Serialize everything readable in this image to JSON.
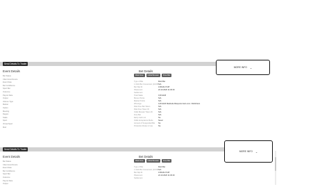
{
  "panel1": {
    "tag": "Send Details To Trader",
    "left_title": "Event Details",
    "left_items": [
      "Bet Status",
      "Client Host Device",
      "Event Date",
      "Bet Confidence",
      "Sport Bet",
      "Outcome",
      "Payout Date",
      "Output",
      "Volume Type",
      "Market",
      "Option",
      "Meeting",
      "Region",
      "Stake",
      "Sport",
      "Virtual Sport",
      "Mod"
    ],
    "right_title": "Bet Details",
    "chips": [
      "Risk Free",
      "Odds Booster",
      "Free Bet"
    ],
    "chip_counts": [
      "N/A",
      "N/A",
      "N/A"
    ],
    "rows": [
      {
        "k": "Type of Bet",
        "v": "Multi Bet"
      },
      {
        "k": "1 Click Bet Conversion (1CCB)",
        "v": "N/A"
      },
      {
        "k": "Bet Slip ID",
        "v": "1XRAKLYNJP"
      },
      {
        "k": "Placement",
        "v": "22.10.2020 11:36:40"
      },
      {
        "k": "Settlement",
        "v": ""
      },
      {
        "k": "Total Stake",
        "v": "0,00 EUR"
      },
      {
        "k": "Bonus Points",
        "v": "N/A"
      },
      {
        "k": "Market Points",
        "v": "N/A"
      },
      {
        "k": "Winnings",
        "v": "0,00 EUR  Mattitude Betsports.bwin.com / WebClient"
      },
      {
        "k": "Risk Free Bet Token",
        "v": "N/A"
      },
      {
        "k": "Risk Free Token ID",
        "v": "N/A"
      },
      {
        "k": "Odds Booster Token ID",
        "v": "N/A"
      },
      {
        "k": "Free Bet",
        "v": "N/A"
      },
      {
        "k": "Early Cash out",
        "v": "No"
      },
      {
        "k": "Odds Acceptance Mode",
        "v": "Never"
      },
      {
        "k": "Amount of Suspended Bet",
        "v": "No"
      },
      {
        "k": "Protection Rules in Use",
        "v": "No"
      }
    ],
    "more_info": "MORE INFO"
  },
  "panel2": {
    "tag": "Send Details To Trader",
    "left_title": "Event Details",
    "left_items": [
      "Bet Status",
      "Client Host Device",
      "Event Date",
      "Bet Confidence",
      "Sport Bet",
      "Outcome",
      "Payout Date",
      "Output"
    ],
    "right_title": "Bet Details",
    "chips": [
      "Risk Free",
      "Odds Booster",
      "Free Bet"
    ],
    "chip_counts": [
      "N/A",
      "N/A",
      "N/A"
    ],
    "rows": [
      {
        "k": "Type of Bet",
        "v": "Multi Bet"
      },
      {
        "k": "1 Click Bet Conversion (1CCB)",
        "v": "N/A"
      },
      {
        "k": "Bet Slip ID",
        "v": "1XRAKLYNJP"
      },
      {
        "k": "Placement",
        "v": "22.10.2020 11:36:40"
      },
      {
        "k": "Settlement",
        "v": ""
      }
    ],
    "more_info": "MORE INFO"
  }
}
